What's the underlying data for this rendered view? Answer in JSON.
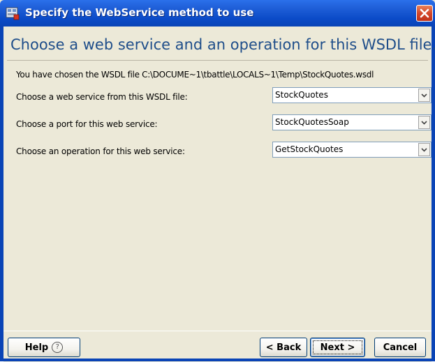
{
  "window": {
    "title": "Specify the WebService method to use",
    "icons": {
      "app": "webservice-app-icon",
      "close": "close-icon"
    }
  },
  "main": {
    "heading": "Choose a web service and an operation for this WSDL file.",
    "wsdl_info": "You have chosen the WSDL file C:\\DOCUME~1\\tbattle\\LOCALS~1\\Temp\\StockQuotes.wsdl",
    "rows": [
      {
        "label": "Choose a web service from this WSDL file:",
        "value": "StockQuotes"
      },
      {
        "label": "Choose a port for this web service:",
        "value": "StockQuotesSoap"
      },
      {
        "label": "Choose an operation for this web service:",
        "value": "GetStockQuotes"
      }
    ]
  },
  "buttons": {
    "help": "Help",
    "back": "< Back",
    "next": "Next >",
    "cancel": "Cancel"
  },
  "colors": {
    "titlebar": "#0b4bc8",
    "heading": "#1f4e8a",
    "panel": "#ece9d8"
  }
}
